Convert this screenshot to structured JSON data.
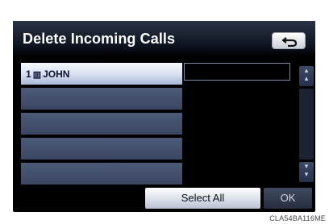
{
  "screen": {
    "title": "Delete Incoming Calls",
    "back_icon": "return-arrow-icon"
  },
  "list": {
    "rows": [
      {
        "index": "1",
        "icon": "phone-icon",
        "name": "JOHN",
        "selected": true
      },
      {
        "index": "",
        "name": "",
        "selected": false
      },
      {
        "index": "",
        "name": "",
        "selected": false
      },
      {
        "index": "",
        "name": "",
        "selected": false
      },
      {
        "index": "",
        "name": "",
        "selected": false
      }
    ]
  },
  "buttons": {
    "select_all": "Select All",
    "ok": "OK"
  },
  "scroll": {
    "up_icon": "page-up-icon",
    "down_icon": "page-down-icon"
  },
  "caption": "CLA54BA116ME"
}
